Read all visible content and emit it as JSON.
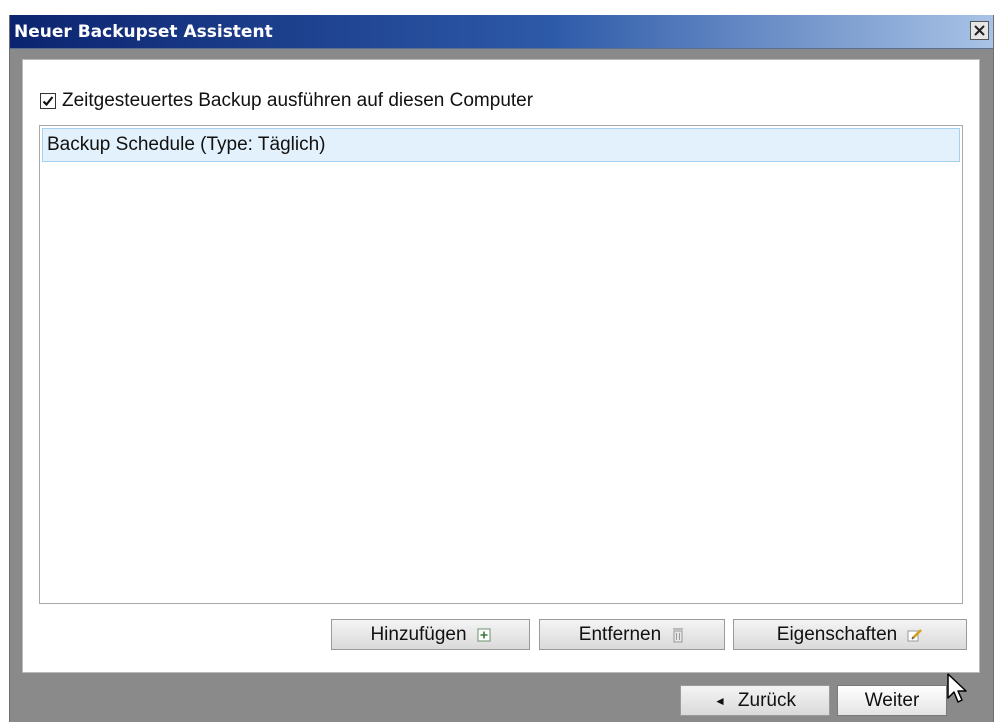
{
  "window": {
    "title": "Neuer Backupset Assistent",
    "close_icon": "close-icon"
  },
  "schedule": {
    "checkbox_label": "Zeitgesteuertes Backup ausführen auf diesen Computer",
    "checked": true,
    "items": [
      {
        "label": "Backup Schedule (Type: Täglich)",
        "selected": true
      }
    ]
  },
  "actions": {
    "add_label": "Hinzufügen",
    "add_icon": "add-icon",
    "remove_label": "Entfernen",
    "remove_icon": "trash-icon",
    "properties_label": "Eigenschaften",
    "properties_icon": "edit-icon"
  },
  "navigation": {
    "back_label": "Zurück",
    "back_icon": "left-arrow-icon",
    "next_label": "Weiter"
  },
  "colors": {
    "title_gradient_start": "#0c2470",
    "title_gradient_end": "#a9c3e6",
    "selection_bg": "#e3f1fc",
    "dialog_bg": "#8a8a8a"
  }
}
